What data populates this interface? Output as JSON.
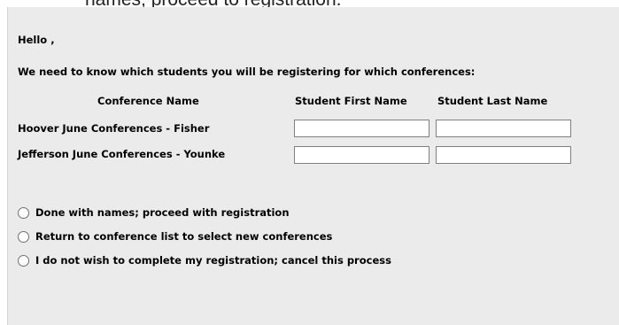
{
  "top_partial_text": "names; proceed to registration.",
  "greeting": "Hello ,",
  "intro": "We need to know which students you will be registering for which conferences:",
  "table": {
    "headers": [
      "Conference Name",
      "Student First Name",
      "Student Last Name"
    ],
    "rows": [
      {
        "conference": "Hoover June Conferences - Fisher",
        "first_name": "",
        "last_name": ""
      },
      {
        "conference": "Jefferson June Conferences - Younke",
        "first_name": "",
        "last_name": ""
      }
    ]
  },
  "options": [
    {
      "label": "Done with names; proceed with registration",
      "selected": false
    },
    {
      "label": "Return to conference list to select new conferences",
      "selected": false
    },
    {
      "label": "I do not wish to complete my registration; cancel this process",
      "selected": false
    }
  ]
}
